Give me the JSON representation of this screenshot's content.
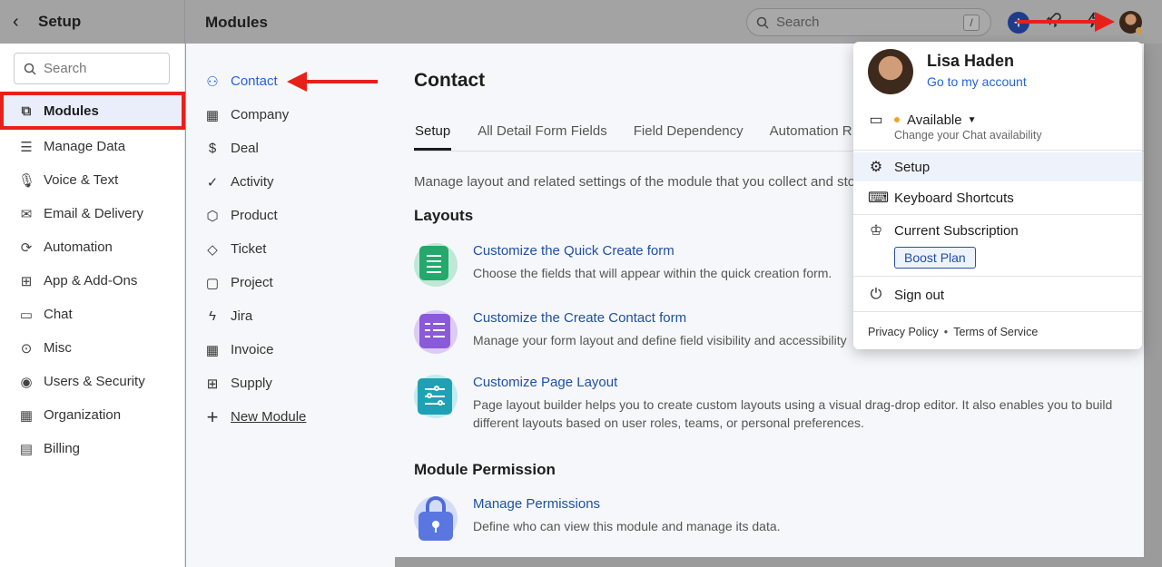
{
  "topbar": {
    "back_icon": "chevron-left-icon",
    "setup_title": "Setup",
    "modules_title": "Modules",
    "search_placeholder": "Search",
    "search_shortcut": "/",
    "plus_label": "+"
  },
  "sidebar": {
    "search_placeholder": "Search",
    "items": [
      {
        "label": "Modules",
        "icon": "sitemap-icon"
      },
      {
        "label": "Manage Data",
        "icon": "database-icon"
      },
      {
        "label": "Voice & Text",
        "icon": "microphone-icon"
      },
      {
        "label": "Email & Delivery",
        "icon": "envelope-icon"
      },
      {
        "label": "Automation",
        "icon": "automation-icon"
      },
      {
        "label": "App & Add-Ons",
        "icon": "grid-icon"
      },
      {
        "label": "Chat",
        "icon": "chat-icon"
      },
      {
        "label": "Misc",
        "icon": "more-circle-icon"
      },
      {
        "label": "Users & Security",
        "icon": "user-circle-icon"
      },
      {
        "label": "Organization",
        "icon": "building-icon"
      },
      {
        "label": "Billing",
        "icon": "billing-icon"
      }
    ]
  },
  "modules": {
    "items": [
      {
        "label": "Contact",
        "icon": "person-icon"
      },
      {
        "label": "Company",
        "icon": "building-icon"
      },
      {
        "label": "Deal",
        "icon": "dollar-circle-icon"
      },
      {
        "label": "Activity",
        "icon": "check-circle-icon"
      },
      {
        "label": "Product",
        "icon": "box-icon"
      },
      {
        "label": "Ticket",
        "icon": "tag-icon"
      },
      {
        "label": "Project",
        "icon": "project-icon"
      },
      {
        "label": "Jira",
        "icon": "bolt-icon"
      },
      {
        "label": "Invoice",
        "icon": "invoice-icon"
      },
      {
        "label": "Supply",
        "icon": "supply-icon"
      }
    ],
    "new_module": "New Module"
  },
  "main": {
    "title": "Contact",
    "tabs": [
      "Setup",
      "All Detail Form Fields",
      "Field Dependency",
      "Automation R"
    ],
    "description": "Manage layout and related settings of the module that you collect and sto",
    "layouts_heading": "Layouts",
    "cards": [
      {
        "title": "Customize the Quick Create form",
        "desc": "Choose the fields that will appear within the quick creation form."
      },
      {
        "title": "Customize the Create Contact form",
        "desc": "Manage your form layout and define field visibility and accessibility"
      },
      {
        "title": "Customize Page Layout",
        "desc": "Page layout builder helps you to create custom layouts using a visual drag-drop editor. It also enables you to build different layouts based on user roles, teams, or personal preferences."
      }
    ],
    "permission_heading": "Module Permission",
    "permission_card": {
      "title": "Manage Permissions",
      "desc": "Define who can view this module and manage its data."
    }
  },
  "dropdown": {
    "name": "Lisa Haden",
    "account_link": "Go to my account",
    "status": "Available",
    "status_sub": "Change your Chat availability",
    "setup": "Setup",
    "shortcuts": "Keyboard Shortcuts",
    "subscription": "Current Subscription",
    "plan": "Boost Plan",
    "signout": "Sign out",
    "privacy": "Privacy Policy",
    "terms": "Terms of Service"
  },
  "colors": {
    "accent": "#2563d9",
    "link": "#1f4fa8",
    "annotation": "#e8201a",
    "status_available": "#f0a524"
  }
}
